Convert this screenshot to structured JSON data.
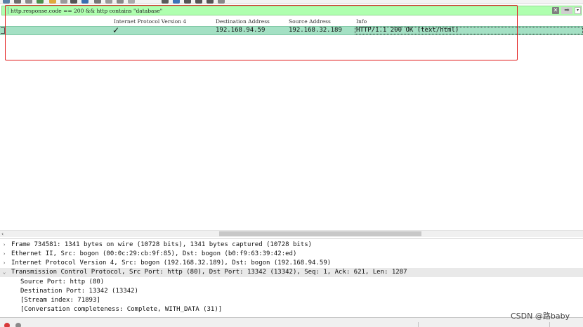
{
  "display_filter": {
    "expression": "http.response.code == 200 && http contains \"database\""
  },
  "packet_list": {
    "columns": [
      "Internet Protocol Version 4",
      "Destination Address",
      "Source Address",
      "Info"
    ],
    "rows": [
      {
        "ipv4": "✓",
        "destination": "192.168.94.59",
        "source": "192.168.32.189",
        "info": "HTTP/1.1 200 OK  (text/html)"
      }
    ]
  },
  "details": {
    "lines": [
      {
        "arrow": "›",
        "text": "Frame 734581: 1341 bytes on wire (10728 bits), 1341 bytes captured (10728 bits)"
      },
      {
        "arrow": "›",
        "text": "Ethernet II, Src: bogon (00:0c:29:cb:9f:85), Dst: bogon (b0:f9:63:39:42:ed)"
      },
      {
        "arrow": "›",
        "text": "Internet Protocol Version 4, Src: bogon (192.168.32.189), Dst: bogon (192.168.94.59)"
      },
      {
        "arrow": "⌄",
        "text": "Transmission Control Protocol, Src Port: http (80), Dst Port: 13342 (13342), Seq: 1, Ack: 621, Len: 1287"
      },
      {
        "arrow": "",
        "text": "Source Port: http (80)"
      },
      {
        "arrow": "",
        "text": "Destination Port: 13342 (13342)"
      },
      {
        "arrow": "",
        "text": "[Stream index: 71893]"
      },
      {
        "arrow": "",
        "text": "[Conversation completeness: Complete, WITH_DATA (31)]"
      }
    ]
  },
  "watermark": "CSDN @路baby",
  "colors": {
    "filter_valid": "#afffaf",
    "row_http": "#a4e0c4",
    "annotation_box": "#e21b1b"
  }
}
